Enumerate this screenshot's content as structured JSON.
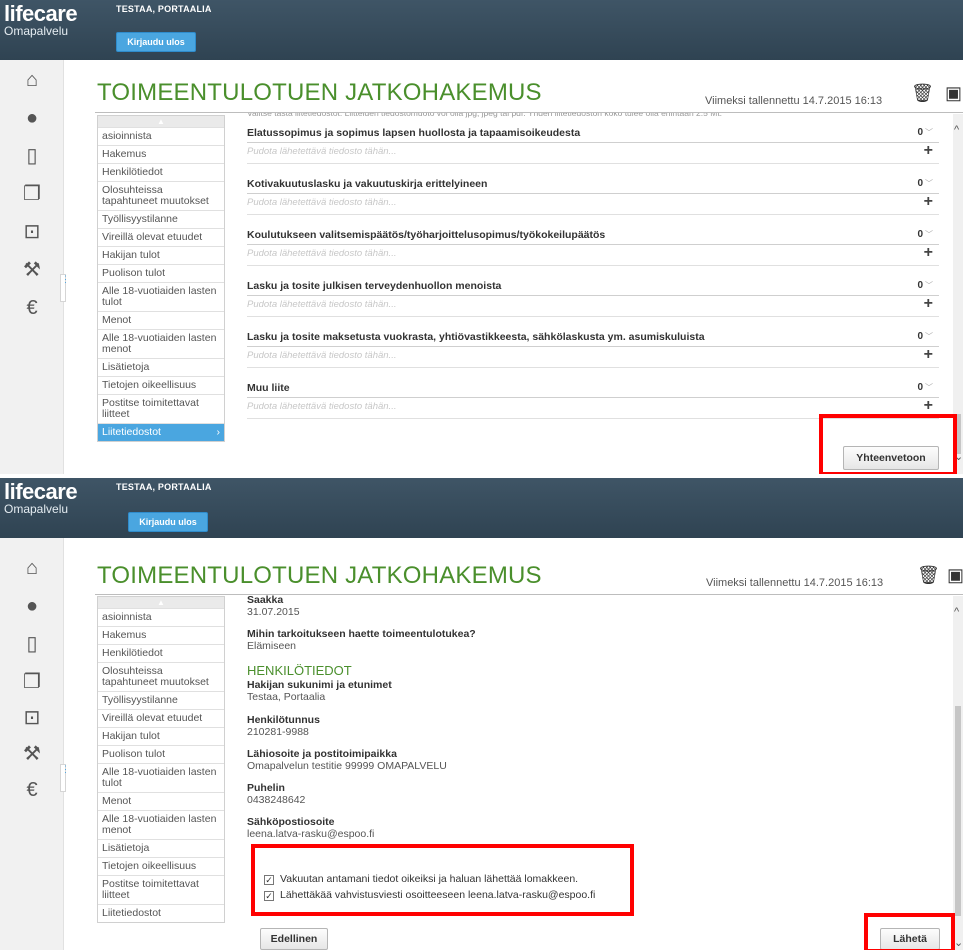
{
  "app": {
    "brand": "lifecare",
    "sub": "Omapalvelu",
    "user": "TESTAA, PORTAALIA",
    "logout": "Kirjaudu ulos"
  },
  "page_title": "TOIMEENTULOTUEN JATKOHAKEMUS",
  "saved_label": "Viimeksi tallennettu 14.7.2015 16:13",
  "icons": [
    "home-icon",
    "user-icon",
    "new-document-icon",
    "documents-icon",
    "inbox-icon",
    "gavel-icon",
    "euro-icon",
    "trash-icon",
    "save-icon"
  ],
  "menu": [
    "asioinnista",
    "Hakemus",
    "Henkilötiedot",
    "Olosuhteissa tapahtuneet muutokset",
    "Työllisyystilanne",
    "Vireillä olevat etuudet",
    "Hakijan tulot",
    "Puolison tulot",
    "Alle 18-vuotiaiden lasten tulot",
    "Menot",
    "Alle 18-vuotiaiden lasten menot",
    "Lisätietoja",
    "Tietojen oikeellisuus",
    "Postitse toimitettavat liitteet",
    "Liitetiedostot"
  ],
  "menu_arrow": "›",
  "cut_text": "Valitse tästä liitetiedostot. Liitteiden tiedostomuoto voi olla jpg, jpeg tai pdf. Yhden liitetiedoston koko tulee olla enintään 2.5 Mt.",
  "attachments": [
    {
      "title": "Elatussopimus ja sopimus lapsen huollosta ja tapaamisoikeudesta",
      "count": "0"
    },
    {
      "title": "Kotivakuutuslasku ja vakuutuskirja erittelyineen",
      "count": "0"
    },
    {
      "title": "Koulutukseen valitsemispäätös/työharjoittelusopimus/työkokeilupäätös",
      "count": "0"
    },
    {
      "title": "Lasku ja tosite julkisen terveydenhuollon menoista",
      "count": "0"
    },
    {
      "title": "Lasku ja tosite maksetusta vuokrasta, yhtiövastikkeesta, sähkölaskusta ym. asumiskuluista",
      "count": "0"
    },
    {
      "title": "Muu liite",
      "count": "0"
    }
  ],
  "drop_hint": "Pudota lähetettävä tiedosto tähän...",
  "summary_button": "Yhteenvetoon",
  "summary": {
    "until_label": "Saakka",
    "until_value": "31.07.2015",
    "purpose_label": "Mihin tarkoitukseen haette toimeentulotukea?",
    "purpose_value": "Elämiseen",
    "section": "HENKILÖTIEDOT",
    "name_label": "Hakijan sukunimi ja etunimet",
    "name_value": "Testaa, Portaalia",
    "ssn_label": "Henkilötunnus",
    "ssn_value": "210281-9988",
    "address_label": "Lähiosoite ja postitoimipaikka",
    "address_value": "Omapalvelun testitie 99999 OMAPALVELU",
    "phone_label": "Puhelin",
    "phone_value": "0438248642",
    "email_label": "Sähköpostiosoite",
    "email_value": "leena.latva-rasku@espoo.fi"
  },
  "confirm1": "Vakuutan antamani tiedot oikeiksi ja haluan lähettää lomakkeen.",
  "confirm2": "Lähettäkää vahvistusviesti osoitteeseen leena.latva-rasku@espoo.fi",
  "prev_button": "Edellinen",
  "send_button": "Lähetä",
  "colors": {
    "accent": "#4aa6e0",
    "title_green": "#4a8f2c",
    "highlight": "#ff0000",
    "header": "#34495a"
  }
}
